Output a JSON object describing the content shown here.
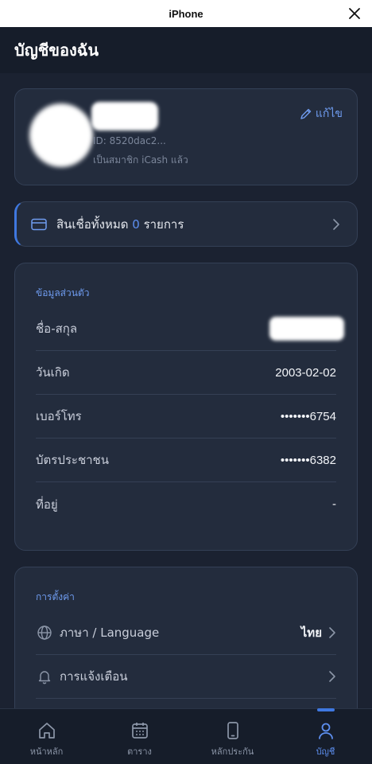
{
  "system": {
    "title": "iPhone"
  },
  "header": {
    "title": "บัญชีของฉัน"
  },
  "profile": {
    "id_text": "ID: 8520dac2...",
    "member_text": "เป็นสมาชิก iCash แล้ว",
    "edit_label": "แก้ไข"
  },
  "credit": {
    "prefix": "สินเชื่อทั้งหมด",
    "count": "0",
    "suffix": "รายการ"
  },
  "personal": {
    "title": "ข้อมูลส่วนตัว",
    "rows": [
      {
        "label": "ชื่อ-สกุล",
        "value": ""
      },
      {
        "label": "วันเกิด",
        "value": "2003-02-02"
      },
      {
        "label": "เบอร์โทร",
        "value": "•••••••6754"
      },
      {
        "label": "บัตรประชาชน",
        "value": "•••••••6382"
      },
      {
        "label": "ที่อยู่",
        "value": "-"
      }
    ]
  },
  "settings": {
    "title": "การตั้งค่า",
    "items": [
      {
        "label": "ภาษา / Language",
        "value": "ไทย",
        "icon": "globe-icon"
      },
      {
        "label": "การแจ้งเตือน",
        "value": "",
        "icon": "bell-icon"
      }
    ]
  },
  "tabs": [
    {
      "label": "หน้าหลัก",
      "icon": "home-icon"
    },
    {
      "label": "ตาราง",
      "icon": "calendar-icon"
    },
    {
      "label": "หลักประกัน",
      "icon": "phone-icon"
    },
    {
      "label": "บัญชี",
      "icon": "user-icon",
      "active": true
    }
  ],
  "colors": {
    "accent": "#5d8ff0",
    "background": "#1b2231",
    "card": "#232c3d"
  }
}
